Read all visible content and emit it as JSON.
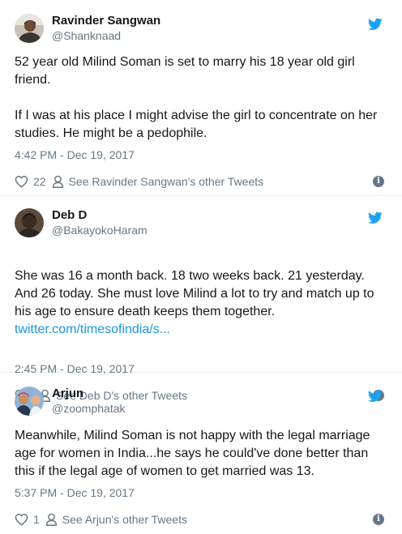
{
  "tweets": [
    {
      "name": "Ravinder Sangwan",
      "handle": "@Shanknaad",
      "text": "52 year old Milind Soman is set to marry his 18 year old girl friend.\n\nIf I was at his place I might advise the girl to concentrate on her studies. He might be a pedophile.",
      "link": "",
      "timestamp": "4:42 PM - Dec 19, 2017",
      "likes": "22",
      "other_tweets": "See Ravinder Sangwan's other Tweets"
    },
    {
      "name": "Deb D",
      "handle": "@BakayokoHaram",
      "text": "She was 16 a month back. 18 two weeks back. 21 yesterday. And 26 today. She must love Milind a lot to try and match up to his age to ensure death keeps them together.",
      "link": "twitter.com/timesofindia/s...",
      "timestamp": "2:45 PM - Dec 19, 2017",
      "likes": "",
      "other_tweets": "See Deb D's other Tweets"
    },
    {
      "name": "Arjun",
      "handle": "@zoomphatak",
      "text": "Meanwhile, Milind Soman is not happy with the legal marriage age for women in India...he says he could've done better than this if the legal age of women to get married was 13.",
      "link": "",
      "timestamp": "5:37 PM - Dec 19, 2017",
      "likes": "1",
      "other_tweets": "See Arjun's other Tweets"
    }
  ],
  "icons": {
    "bird": "twitter-bird-icon",
    "heart": "heart-icon",
    "person": "person-icon",
    "info": "info-icon"
  },
  "colors": {
    "twitter_blue": "#1da1f2",
    "link_blue": "#1b95e0",
    "gray": "#657786",
    "text": "#14171a"
  }
}
